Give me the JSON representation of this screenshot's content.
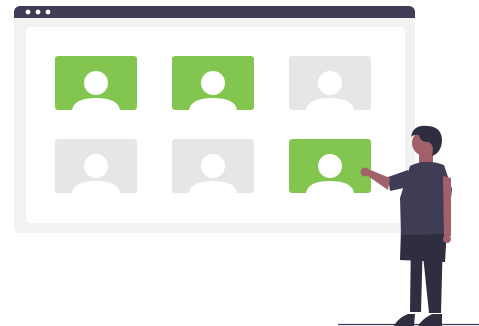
{
  "window": {
    "title_bar_color": "#3f3d56",
    "frame_color": "#f2f2f2",
    "panel_color": "#ffffff",
    "control_dots": [
      "dot",
      "dot",
      "dot"
    ]
  },
  "profile_cards": [
    {
      "state": "selected",
      "icon": "user-icon"
    },
    {
      "state": "selected",
      "icon": "user-icon"
    },
    {
      "state": "unselected",
      "icon": "user-icon"
    },
    {
      "state": "unselected",
      "icon": "user-icon"
    },
    {
      "state": "unselected",
      "icon": "user-icon"
    },
    {
      "state": "selected",
      "icon": "user-icon"
    }
  ],
  "colors": {
    "selected": "#83c64f",
    "unselected": "#e6e6e6",
    "avatar": "#ffffff",
    "skin": "#a0616a",
    "hair": "#2f2e41",
    "shirt": "#3f3d56",
    "pants": "#2f2e41",
    "ground": "#3f3d56"
  },
  "illustration": {
    "figure": "person-pointing-at-card"
  }
}
